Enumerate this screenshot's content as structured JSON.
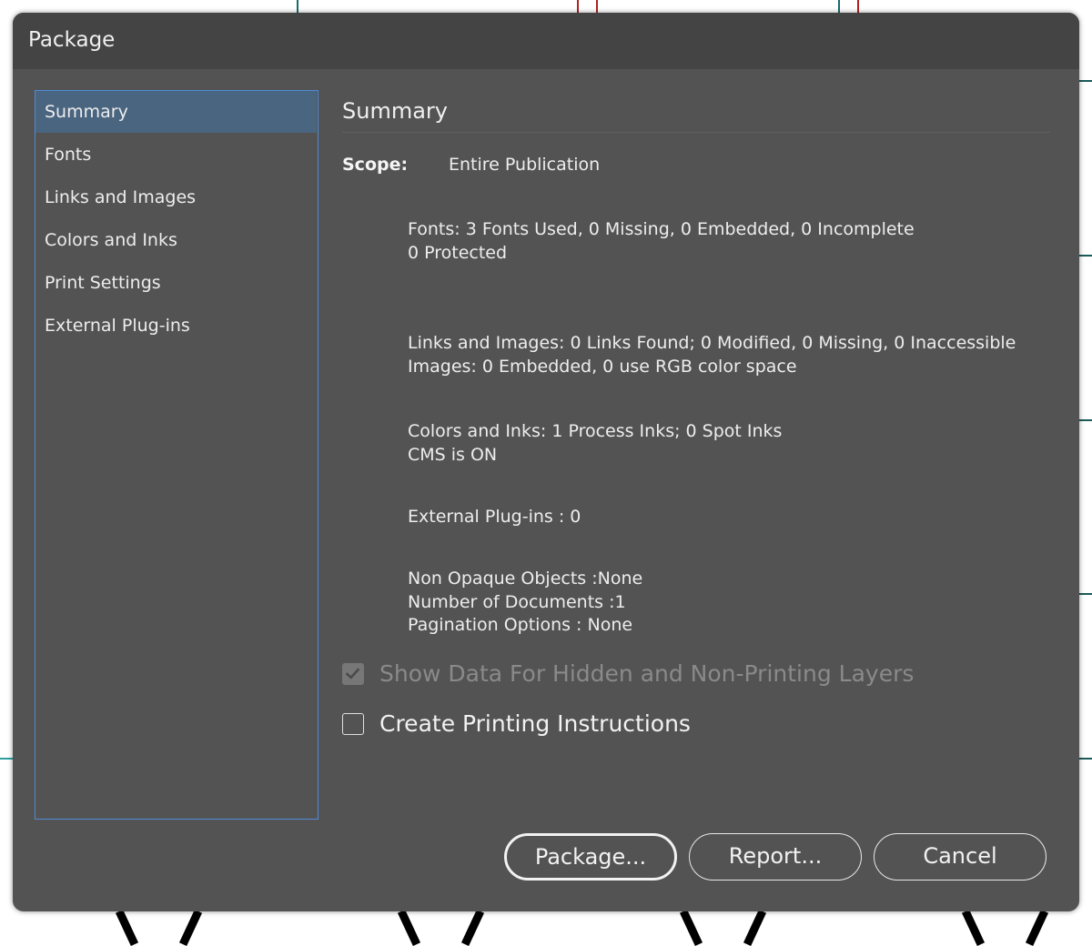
{
  "window": {
    "title": "Package"
  },
  "sidebar": {
    "items": [
      {
        "label": "Summary",
        "selected": true
      },
      {
        "label": "Fonts",
        "selected": false
      },
      {
        "label": "Links and Images",
        "selected": false
      },
      {
        "label": "Colors and Inks",
        "selected": false
      },
      {
        "label": "Print Settings",
        "selected": false
      },
      {
        "label": "External Plug-ins",
        "selected": false
      }
    ]
  },
  "summary": {
    "heading": "Summary",
    "scope_label": "Scope:",
    "scope_value": "Entire Publication",
    "fonts_line1": "Fonts: 3 Fonts Used, 0 Missing, 0 Embedded, 0 Incomplete",
    "fonts_line2": "0 Protected",
    "links_line1": "Links and Images: 0 Links Found; 0 Modified, 0 Missing, 0 Inaccessible",
    "links_line2": "Images: 0 Embedded, 0 use RGB color space",
    "colors_line1": "Colors and Inks: 1 Process Inks; 0 Spot Inks",
    "colors_line2": "CMS is ON",
    "plugins_line": "External Plug-ins : 0",
    "opaque_line": "Non Opaque Objects :None",
    "documents_line": "Number of Documents :1",
    "pagination_line": "Pagination Options : None"
  },
  "options": {
    "show_hidden_label": "Show Data For Hidden and Non-Printing Layers",
    "show_hidden_checked": true,
    "show_hidden_enabled": false,
    "printing_instructions_label": "Create Printing Instructions",
    "printing_instructions_checked": false
  },
  "buttons": {
    "package": "Package...",
    "report": "Report...",
    "cancel": "Cancel"
  },
  "colors": {
    "dialog_bg": "#535353",
    "titlebar_bg": "#444444",
    "selection_bg": "#4a6580",
    "focus_border": "#4d8bd6"
  }
}
